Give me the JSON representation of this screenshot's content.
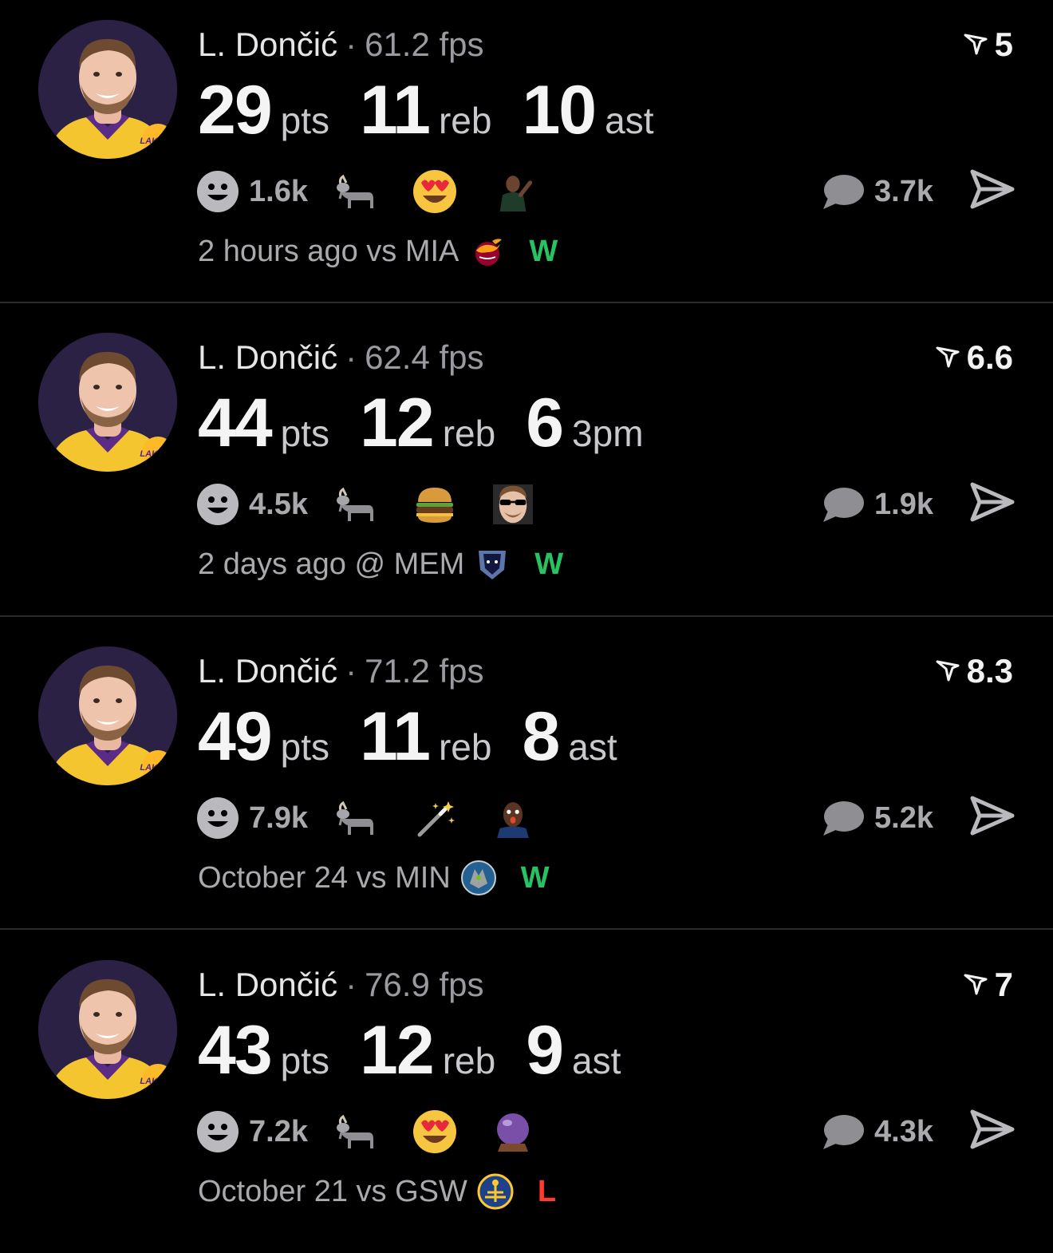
{
  "colors": {
    "win": "#27c263",
    "loss": "#ff3b30",
    "text_secondary": "#a9a9ae"
  },
  "posts": [
    {
      "player": "L. Dončić",
      "separator": "·",
      "fps": "61.2 fps",
      "score": "5",
      "stats": [
        {
          "value": "29",
          "unit": "pts"
        },
        {
          "value": "11",
          "unit": "reb"
        },
        {
          "value": "10",
          "unit": "ast"
        }
      ],
      "reactions_count": "1.6k",
      "emojis": [
        "goat-emoji",
        "heart-eyes-emoji",
        "player-celebration-sticker"
      ],
      "comments_count": "3.7k",
      "when": "2 hours ago vs MIA",
      "opponent_logo": "heat-logo-icon",
      "result": "W"
    },
    {
      "player": "L. Dončić",
      "separator": "·",
      "fps": "62.4 fps",
      "score": "6.6",
      "stats": [
        {
          "value": "44",
          "unit": "pts"
        },
        {
          "value": "12",
          "unit": "reb"
        },
        {
          "value": "6",
          "unit": "3pm"
        }
      ],
      "reactions_count": "4.5k",
      "emojis": [
        "goat-emoji",
        "burger-emoji",
        "sunglasses-player-sticker"
      ],
      "comments_count": "1.9k",
      "when": "2 days ago @ MEM",
      "opponent_logo": "grizzlies-logo-icon",
      "result": "W"
    },
    {
      "player": "L. Dončić",
      "separator": "·",
      "fps": "71.2 fps",
      "score": "8.3",
      "stats": [
        {
          "value": "49",
          "unit": "pts"
        },
        {
          "value": "11",
          "unit": "reb"
        },
        {
          "value": "8",
          "unit": "ast"
        }
      ],
      "reactions_count": "7.9k",
      "emojis": [
        "goat-emoji",
        "magic-wand-emoji",
        "surprised-player-sticker"
      ],
      "comments_count": "5.2k",
      "when": "October 24 vs MIN",
      "opponent_logo": "timberwolves-logo-icon",
      "result": "W"
    },
    {
      "player": "L. Dončić",
      "separator": "·",
      "fps": "76.9 fps",
      "score": "7",
      "stats": [
        {
          "value": "43",
          "unit": "pts"
        },
        {
          "value": "12",
          "unit": "reb"
        },
        {
          "value": "9",
          "unit": "ast"
        }
      ],
      "reactions_count": "7.2k",
      "emojis": [
        "goat-emoji",
        "heart-eyes-emoji",
        "crystal-ball-emoji"
      ],
      "comments_count": "4.3k",
      "when": "October 21 vs GSW",
      "opponent_logo": "warriors-logo-icon",
      "result": "L"
    }
  ]
}
